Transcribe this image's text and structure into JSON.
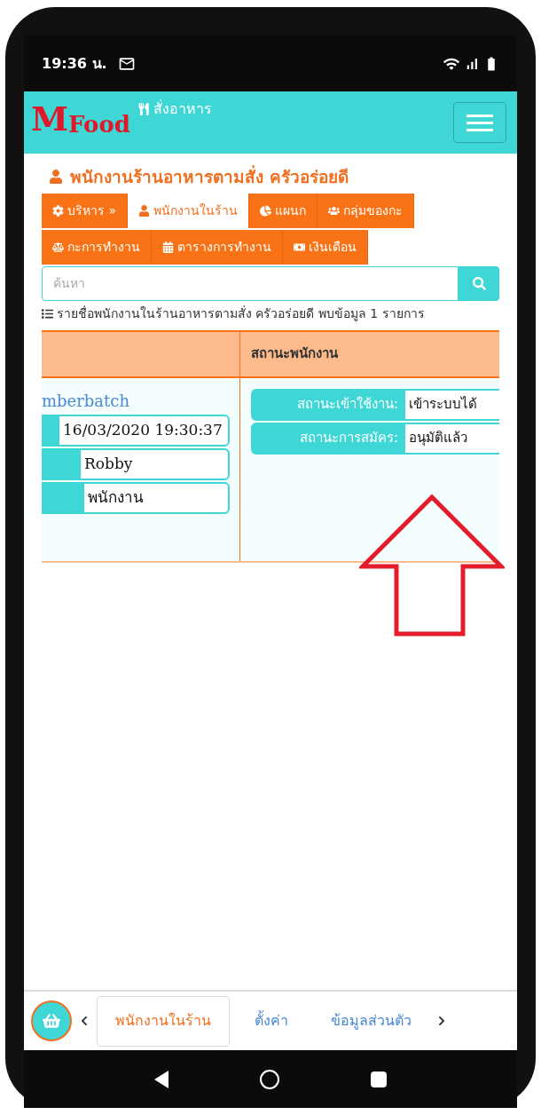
{
  "status_bar": {
    "time": "19:36 น."
  },
  "header": {
    "logo_main": "M",
    "logo_sub": "Food",
    "link": "สั่งอาหาร"
  },
  "page_title": "พนักงานร้านอาหารตามสั่ง ครัวอร่อยดี",
  "menu_tabs": [
    {
      "label": "บริหาร »",
      "selected": false
    },
    {
      "label": "พนักงานในร้าน",
      "selected": true
    },
    {
      "label": "แผนก",
      "selected": false
    },
    {
      "label": "กลุ่มของกะ",
      "selected": false
    },
    {
      "label": "กะการทำงาน",
      "selected": false
    },
    {
      "label": "ตารางการทำงาน",
      "selected": false
    },
    {
      "label": "เงินเดือน",
      "selected": false
    }
  ],
  "search": {
    "placeholder": "ค้นหา"
  },
  "summary": "รายชื่อพนักงานในร้านอาหารตามสั่ง ครัวอร่อยดี พบข้อมูล 1 รายการ",
  "table": {
    "column_2": "สถานะพนักงาน",
    "rows": [
      {
        "name": "mberbatch",
        "fields": [
          "16/03/2020 19:30:37",
          "Robby",
          "พนักงาน"
        ],
        "status": [
          {
            "label": "สถานะเข้าใช้งาน:",
            "value": "เข้าระบบได้"
          },
          {
            "label": "สถานะการสมัคร:",
            "value": "อนุมัติแล้ว"
          }
        ]
      }
    ]
  },
  "bottom_tabs": [
    {
      "label": "พนักงานในร้าน",
      "selected": true
    },
    {
      "label": "ตั้งค่า",
      "selected": false
    },
    {
      "label": "ข้อมูลส่วนตัว",
      "selected": false
    }
  ]
}
